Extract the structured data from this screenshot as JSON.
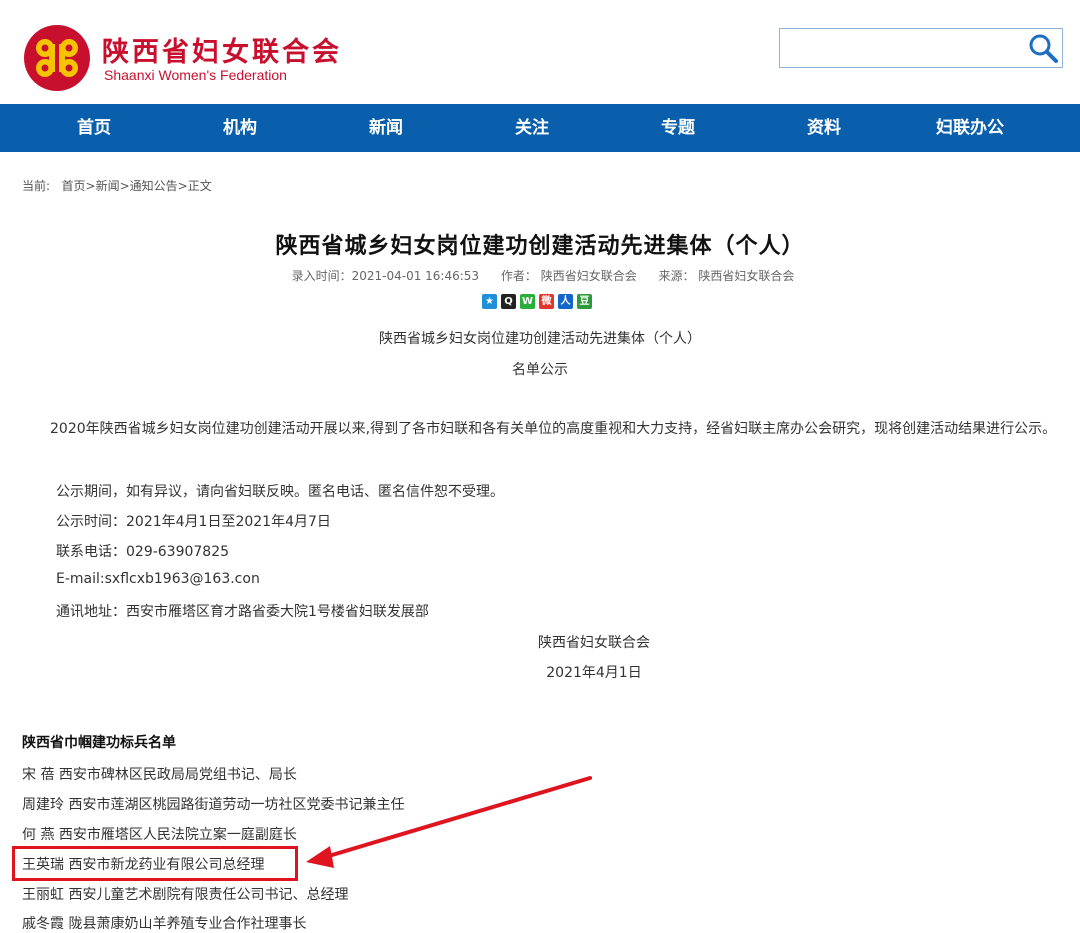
{
  "header": {
    "logo_cn": "陕西省妇女联合会",
    "logo_en": "Shaanxi Women's Federation",
    "search_placeholder": "",
    "icons": {
      "logo": "federation-emblem-icon",
      "search": "search-icon"
    },
    "colors": {
      "brand_red": "#c8102e",
      "logo_yellow": "#f5c400"
    }
  },
  "nav": {
    "color": "#0a5fad",
    "items": [
      "首页",
      "机构",
      "新闻",
      "关注",
      "专题",
      "资料",
      "妇联办公"
    ]
  },
  "breadcrumb": {
    "prefix": "当前:",
    "path": [
      "首页",
      "新闻",
      "通知公告",
      "正文"
    ],
    "separator": ">"
  },
  "article": {
    "title": "陕西省城乡妇女岗位建功创建活动先进集体（个人）",
    "time": "录入时间：2021-04-01 16:46:53",
    "author": "作者： 陕西省妇女联合会",
    "source": "来源： 陕西省妇女联合会",
    "share_icons": [
      {
        "name": "qzone-share-icon",
        "glyph": "★",
        "color": "#1f8fd8"
      },
      {
        "name": "qq-share-icon",
        "glyph": "Q",
        "color": "#222222"
      },
      {
        "name": "wechat-share-icon",
        "glyph": "W",
        "color": "#2aae3a"
      },
      {
        "name": "weibo-share-icon",
        "glyph": "微",
        "color": "#e0362c"
      },
      {
        "name": "renren-share-icon",
        "glyph": "人",
        "color": "#1366c8"
      },
      {
        "name": "douban-share-icon",
        "glyph": "豆",
        "color": "#2f9a3a"
      }
    ],
    "subtitle": "陕西省城乡妇女岗位建功创建活动先进集体（个人）",
    "notice": "名单公示",
    "body": "2020年陕西省城乡妇女岗位建功创建活动开展以来,得到了各市妇联和各有关单位的高度重视和大力支持，经省妇联主席办公会研究，现将创建活动结果进行公示。",
    "lines": [
      "公示期间，如有异议，请向省妇联反映。匿名电话、匿名信件恕不受理。",
      "公示时间：2021年4月1日至2021年4月7日",
      "联系电话：029-63907825",
      "E-mail:sxflcxb1963@163.con",
      "通讯地址：西安市雁塔区育才路省委大院1号楼省妇联发展部"
    ],
    "signature": "陕西省妇女联合会",
    "date": "2021年4月1日",
    "list_title": "陕西省巾帼建功标兵名单",
    "list": [
      "宋  蓓  西安市碑林区民政局局党组书记、局长",
      "周建玲  西安市莲湖区桃园路街道劳动一坊社区党委书记兼主任",
      "何  燕  西安市雁塔区人民法院立案一庭副庭长",
      "王英瑞  西安市新龙药业有限公司总经理",
      "王丽虹  西安儿童艺术剧院有限责任公司书记、总经理",
      "戚冬霞  陇县萧康奶山羊养殖专业合作社理事长"
    ],
    "highlight_color": "#e0141e"
  }
}
